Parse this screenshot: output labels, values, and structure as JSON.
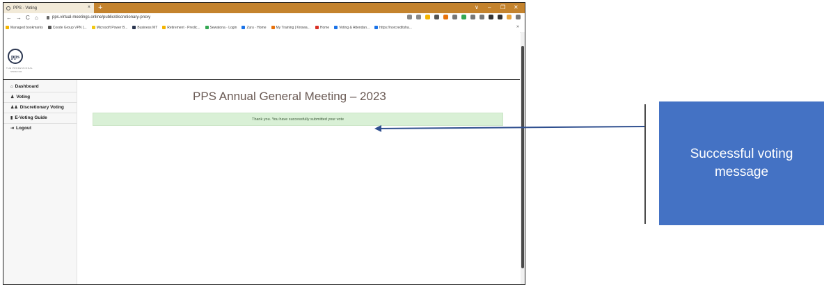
{
  "browser": {
    "tab_title": "PPS - Voting",
    "tab_close": "×",
    "new_tab": "+",
    "window_controls": [
      "∨",
      "–",
      "❐",
      "✕"
    ],
    "nav": {
      "back": "←",
      "forward": "→",
      "reload": "C",
      "home": "⌂"
    },
    "url": "pps.virtual-meetings.online/public/discretionary-proxy",
    "extension_colors": [
      "#888888",
      "#888888",
      "#f4b400",
      "#555555",
      "#e8710a",
      "#777777",
      "#34a853",
      "#777777",
      "#777777",
      "#333333",
      "#333333",
      "#e8a33c",
      "#777777"
    ],
    "bookmarks": [
      {
        "label": "Managed bookmarks",
        "color": "#f4b400"
      },
      {
        "label": "Coode Group VPN (...",
        "color": "#555555"
      },
      {
        "label": "Microsoft Power B...",
        "color": "#f2c811"
      },
      {
        "label": "Business MT",
        "color": "#2b3650"
      },
      {
        "label": "Retirement · Predic...",
        "color": "#f4b400"
      },
      {
        "label": "Sewatona · Login",
        "color": "#34a853"
      },
      {
        "label": "Zuru · Home",
        "color": "#1a73e8"
      },
      {
        "label": "My Training | Knowa...",
        "color": "#e8710a"
      },
      {
        "label": "Home",
        "color": "#d93025"
      },
      {
        "label": "Voting & Attendan...",
        "color": "#1a73e8"
      },
      {
        "label": "https://norcreditsha...",
        "color": "#1a73e8"
      }
    ],
    "bookmarks_more": "»"
  },
  "logo": {
    "text": "pps",
    "tagline": "THE PROFESSIONAL",
    "tagline2": "SINCE 1911"
  },
  "sidebar": {
    "items": [
      {
        "icon": "⌂",
        "label": "Dashboard"
      },
      {
        "icon": "♟",
        "label": "Voting"
      },
      {
        "icon": "♟♟",
        "label": "Discretionary Voting"
      },
      {
        "icon": "▮",
        "label": "E-Voting Guide"
      },
      {
        "icon": "⇥",
        "label": "Logout"
      }
    ]
  },
  "main": {
    "heading": "PPS Annual General Meeting – 2023",
    "alert": "Thank you. You have successfully submitted your vote"
  },
  "annotation": {
    "callout_text": "Successful voting message",
    "callout_color": "#4472c4",
    "arrow_color": "#2f4f8f"
  }
}
